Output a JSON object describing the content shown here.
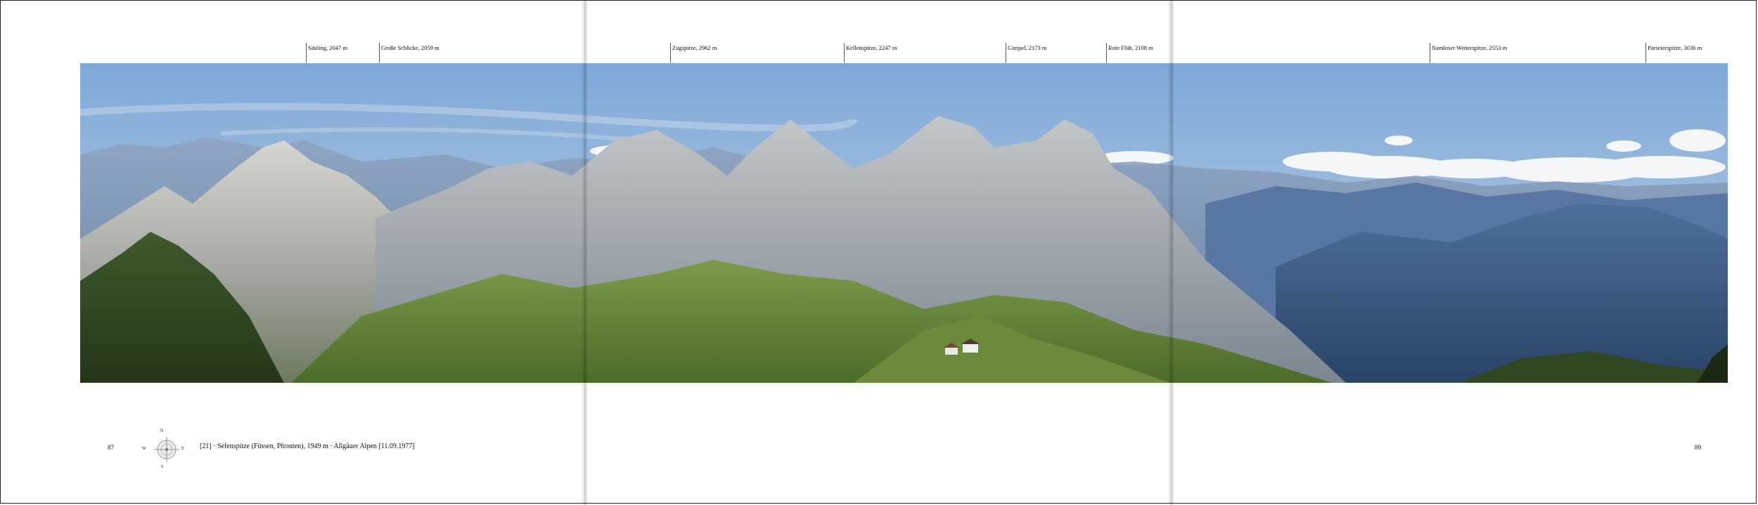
{
  "peaks": [
    {
      "name": "Säuling, 2047 m"
    },
    {
      "name": "Große Schlicke, 2059 m"
    },
    {
      "name": "Zugspitze, 2962 m"
    },
    {
      "name": "Kellenspitze, 2247 m"
    },
    {
      "name": "Gimpel, 2173 m"
    },
    {
      "name": "Rote Flüh, 2108 m"
    },
    {
      "name": "Namloser Wetterspitze, 2553 m"
    },
    {
      "name": "Parseierspitze, 3036 m"
    }
  ],
  "footer": {
    "left_page_number": "87",
    "right_page_number": "89",
    "caption": "[21] · Sefenspitze (Füssen, Pfronten), 1949 m  ·  Allgäuer Alpen [11.09.1977]"
  },
  "compass": {
    "north": "N",
    "south": "S",
    "west": "W",
    "east": "E"
  }
}
